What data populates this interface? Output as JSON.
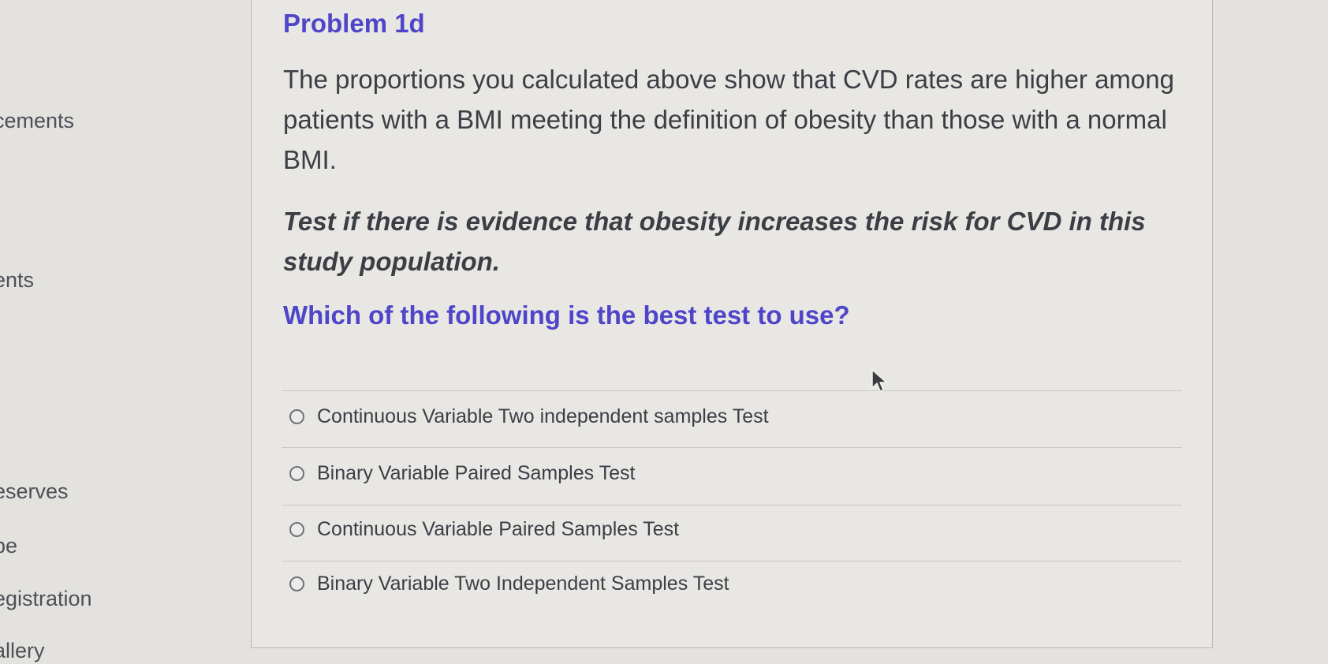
{
  "sidebar": {
    "items": [
      {
        "label": "cements"
      },
      {
        "label": "ents"
      },
      {
        "label": "eserves"
      },
      {
        "label": "pe"
      },
      {
        "label": "egistration"
      },
      {
        "label": "allery"
      }
    ]
  },
  "problem": {
    "title": "Problem 1d",
    "paragraph": "The proportions you calculated above show that CVD rates are higher among patients with a BMI meeting the definition of obesity than those with a normal BMI.",
    "instruction": "Test if there is evidence that obesity increases the risk for CVD in this study population.",
    "question": "Which of the following is the best test to use?",
    "options": [
      {
        "label": "Continuous Variable Two independent samples Test"
      },
      {
        "label": "Binary Variable Paired Samples Test"
      },
      {
        "label": "Continuous Variable Paired Samples Test"
      },
      {
        "label": "Binary Variable Two Independent Samples Test"
      }
    ]
  },
  "colors": {
    "accent": "#4f45c9",
    "text": "#3b3e44",
    "background": "#e4e2df"
  },
  "icons": {
    "cursor": "mouse-pointer-icon",
    "radio": "radio-unchecked-icon"
  }
}
